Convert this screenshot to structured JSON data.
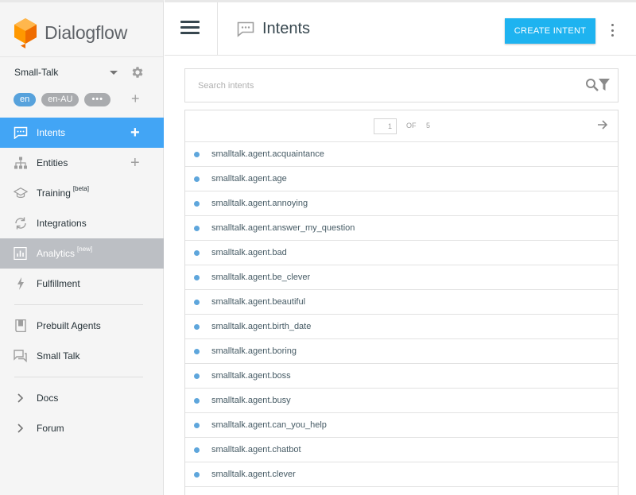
{
  "brand": {
    "name": "Dialogflow"
  },
  "agent": {
    "name": "Small-Talk"
  },
  "languages": [
    "en",
    "en-AU",
    "•••"
  ],
  "nav": {
    "intents": "Intents",
    "entities": "Entities",
    "training": "Training",
    "training_badge": "[beta]",
    "integrations": "Integrations",
    "analytics": "Analytics",
    "analytics_badge": "[new]",
    "fulfillment": "Fulfillment",
    "prebuilt": "Prebuilt Agents",
    "smalltalk": "Small Talk",
    "docs": "Docs",
    "forum": "Forum"
  },
  "header": {
    "title": "Intents",
    "create_label": "CREATE INTENT"
  },
  "search": {
    "placeholder": "Search intents",
    "value": ""
  },
  "pager": {
    "current": "1",
    "of_label": "OF",
    "total": "5"
  },
  "intents": [
    "smalltalk.agent.acquaintance",
    "smalltalk.agent.age",
    "smalltalk.agent.annoying",
    "smalltalk.agent.answer_my_question",
    "smalltalk.agent.bad",
    "smalltalk.agent.be_clever",
    "smalltalk.agent.beautiful",
    "smalltalk.agent.birth_date",
    "smalltalk.agent.boring",
    "smalltalk.agent.boss",
    "smalltalk.agent.busy",
    "smalltalk.agent.can_you_help",
    "smalltalk.agent.chatbot",
    "smalltalk.agent.clever"
  ],
  "colors": {
    "accent": "#42a5f5",
    "button": "#1eb3f0",
    "dot": "#5ea6dc",
    "highlight": "#bcbfc4"
  }
}
